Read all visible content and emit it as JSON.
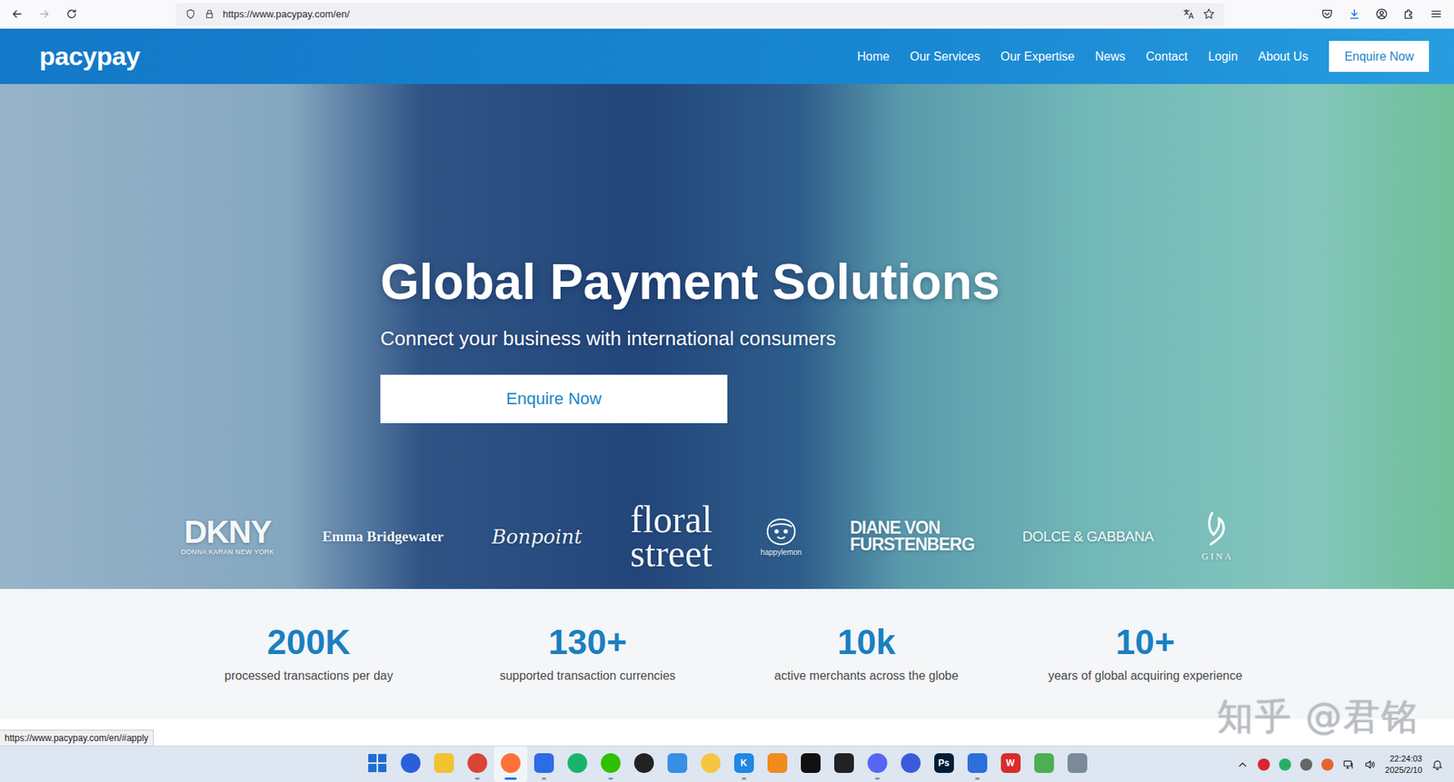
{
  "browser": {
    "url": "https://www.pacypay.com/en/",
    "status_url": "https://www.pacypay.com/en/#apply"
  },
  "site": {
    "logo": "pacypay",
    "nav": [
      {
        "label": "Home"
      },
      {
        "label": "Our Services"
      },
      {
        "label": "Our Expertise"
      },
      {
        "label": "News"
      },
      {
        "label": "Contact"
      },
      {
        "label": "Login"
      },
      {
        "label": "About Us"
      }
    ],
    "cta": "Enquire Now"
  },
  "hero": {
    "title": "Global Payment Solutions",
    "subtitle": "Connect your business with international consumers",
    "button": "Enquire Now",
    "brands": [
      {
        "kind": "block",
        "lines": [
          "DKNY",
          "DONNA KARAN NEW YORK"
        ]
      },
      {
        "kind": "serif",
        "lines": [
          "Emma Bridgewater"
        ]
      },
      {
        "kind": "script",
        "lines": [
          "Bonpoint"
        ]
      },
      {
        "kind": "stack",
        "lines": [
          "floral",
          "street"
        ]
      },
      {
        "kind": "face",
        "lines": [
          "happylemon"
        ]
      },
      {
        "kind": "caps",
        "lines": [
          "DIANE VON",
          "FURSTENBERG"
        ]
      },
      {
        "kind": "wide",
        "lines": [
          "DOLCE & GABBANA"
        ]
      },
      {
        "kind": "mark",
        "lines": [
          "GINA"
        ]
      }
    ]
  },
  "stats": [
    {
      "value": "200K",
      "label": "processed transactions per day"
    },
    {
      "value": "130+",
      "label": "supported transaction currencies"
    },
    {
      "value": "10k",
      "label": "active merchants across the globe"
    },
    {
      "value": "10+",
      "label": "years of global acquiring experience"
    }
  ],
  "watermark": "知乎 @君铭",
  "taskbar": {
    "apps": [
      {
        "kind": "windows",
        "color": "#1f6fd1",
        "open": false,
        "selected": false
      },
      {
        "kind": "circle",
        "color": "#2b5fd9",
        "open": false,
        "selected": false
      },
      {
        "kind": "square",
        "color": "#f2c230",
        "open": false,
        "selected": false
      },
      {
        "kind": "circle",
        "color": "#db4437",
        "open": true,
        "selected": false
      },
      {
        "kind": "circle",
        "color": "#ff7139",
        "open": true,
        "selected": true
      },
      {
        "kind": "square",
        "color": "#2e6be6",
        "open": true,
        "selected": false
      },
      {
        "kind": "circle",
        "color": "#19b36b",
        "open": false,
        "selected": false
      },
      {
        "kind": "circle",
        "color": "#2dc100",
        "open": true,
        "selected": false
      },
      {
        "kind": "circle",
        "color": "#222222",
        "open": false,
        "selected": false
      },
      {
        "kind": "square",
        "color": "#3a8ee6",
        "open": false,
        "selected": false
      },
      {
        "kind": "circle",
        "color": "#f5c542",
        "open": false,
        "selected": false
      },
      {
        "kind": "square",
        "color": "#1e88e5",
        "glyph": "K",
        "open": true,
        "selected": false
      },
      {
        "kind": "square",
        "color": "#f08c1e",
        "open": false,
        "selected": false
      },
      {
        "kind": "square",
        "color": "#111111",
        "open": false,
        "selected": false
      },
      {
        "kind": "square",
        "color": "#222222",
        "open": false,
        "selected": false
      },
      {
        "kind": "circle",
        "color": "#5865f2",
        "open": true,
        "selected": false
      },
      {
        "kind": "circle",
        "color": "#3b5bdb",
        "open": false,
        "selected": false
      },
      {
        "kind": "square",
        "color": "#001e36",
        "glyph": "Ps",
        "open": false,
        "selected": false
      },
      {
        "kind": "square",
        "color": "#2a6fdb",
        "open": true,
        "selected": false
      },
      {
        "kind": "square",
        "color": "#d92b2b",
        "glyph": "W",
        "open": false,
        "selected": false
      },
      {
        "kind": "square",
        "color": "#4caf50",
        "open": false,
        "selected": false
      },
      {
        "kind": "square",
        "color": "#7a8a99",
        "open": false,
        "selected": false
      }
    ],
    "tray": [
      {
        "color": "#d7262e"
      },
      {
        "color": "#2aae67"
      },
      {
        "color": "#666666"
      },
      {
        "color": "#e8632b"
      }
    ],
    "time": "22:24:03",
    "date": "2025/2/10"
  }
}
